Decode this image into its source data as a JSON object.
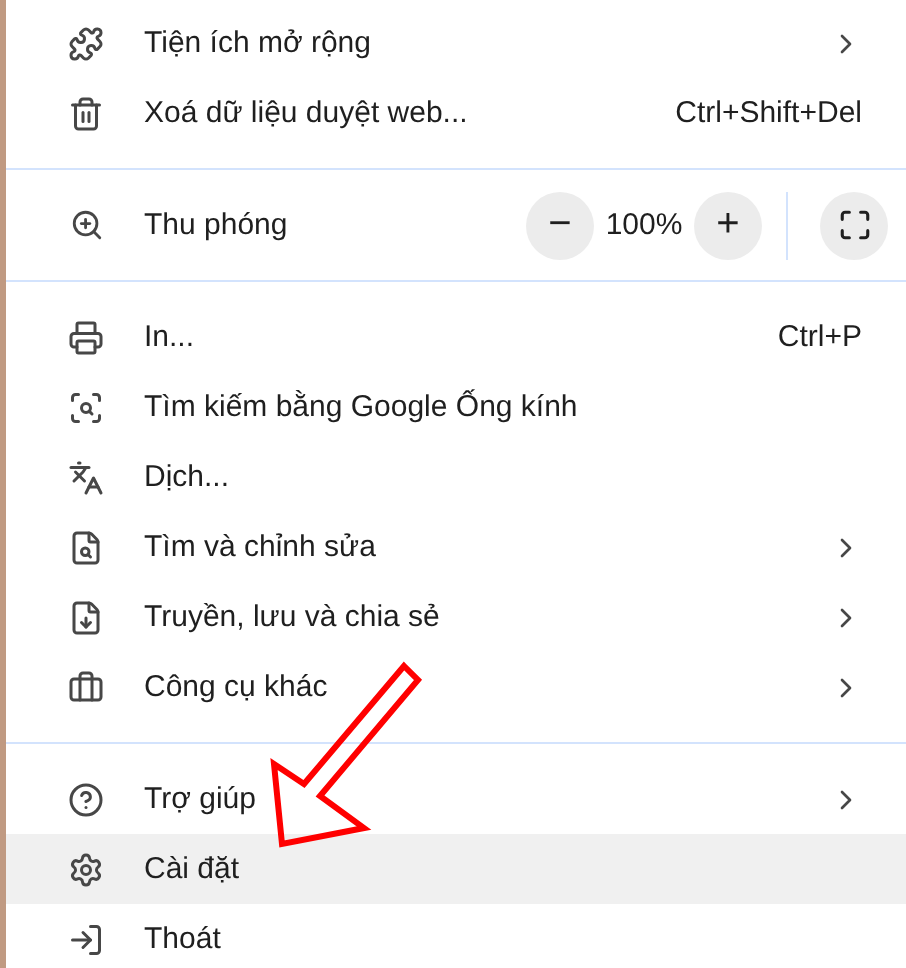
{
  "menu": {
    "items": [
      {
        "kind": "item",
        "label": "Tiện ích mở rộng",
        "submenu": true,
        "selected": false
      },
      {
        "kind": "item",
        "label": "Xoá dữ liệu duyệt web...",
        "shortcut": "Ctrl+Shift+Del",
        "submenu": false,
        "selected": false
      },
      {
        "kind": "divider"
      },
      {
        "kind": "zoom",
        "label": "Thu phóng",
        "zoom_minus": "−",
        "value": "100%",
        "zoom_plus": "+"
      },
      {
        "kind": "divider"
      },
      {
        "kind": "item",
        "label": "In...",
        "shortcut": "Ctrl+P",
        "submenu": false,
        "selected": false
      },
      {
        "kind": "item",
        "label": "Tìm kiếm bằng Google Ống kính",
        "submenu": false,
        "selected": false
      },
      {
        "kind": "item",
        "label": "Dịch...",
        "submenu": false,
        "selected": false
      },
      {
        "kind": "item",
        "label": "Tìm và chỉnh sửa",
        "submenu": true,
        "selected": false
      },
      {
        "kind": "item",
        "label": "Truyền, lưu và chia sẻ",
        "submenu": true,
        "selected": false
      },
      {
        "kind": "item",
        "label": "Công cụ khác",
        "submenu": true,
        "selected": false
      },
      {
        "kind": "divider"
      },
      {
        "kind": "item",
        "label": "Trợ giúp",
        "submenu": true,
        "selected": false
      },
      {
        "kind": "item",
        "label": "Cài đặt",
        "submenu": false,
        "selected": true
      },
      {
        "kind": "item",
        "label": "Thoát",
        "submenu": false,
        "selected": false
      }
    ]
  },
  "annotation": {
    "kind": "arrow"
  }
}
